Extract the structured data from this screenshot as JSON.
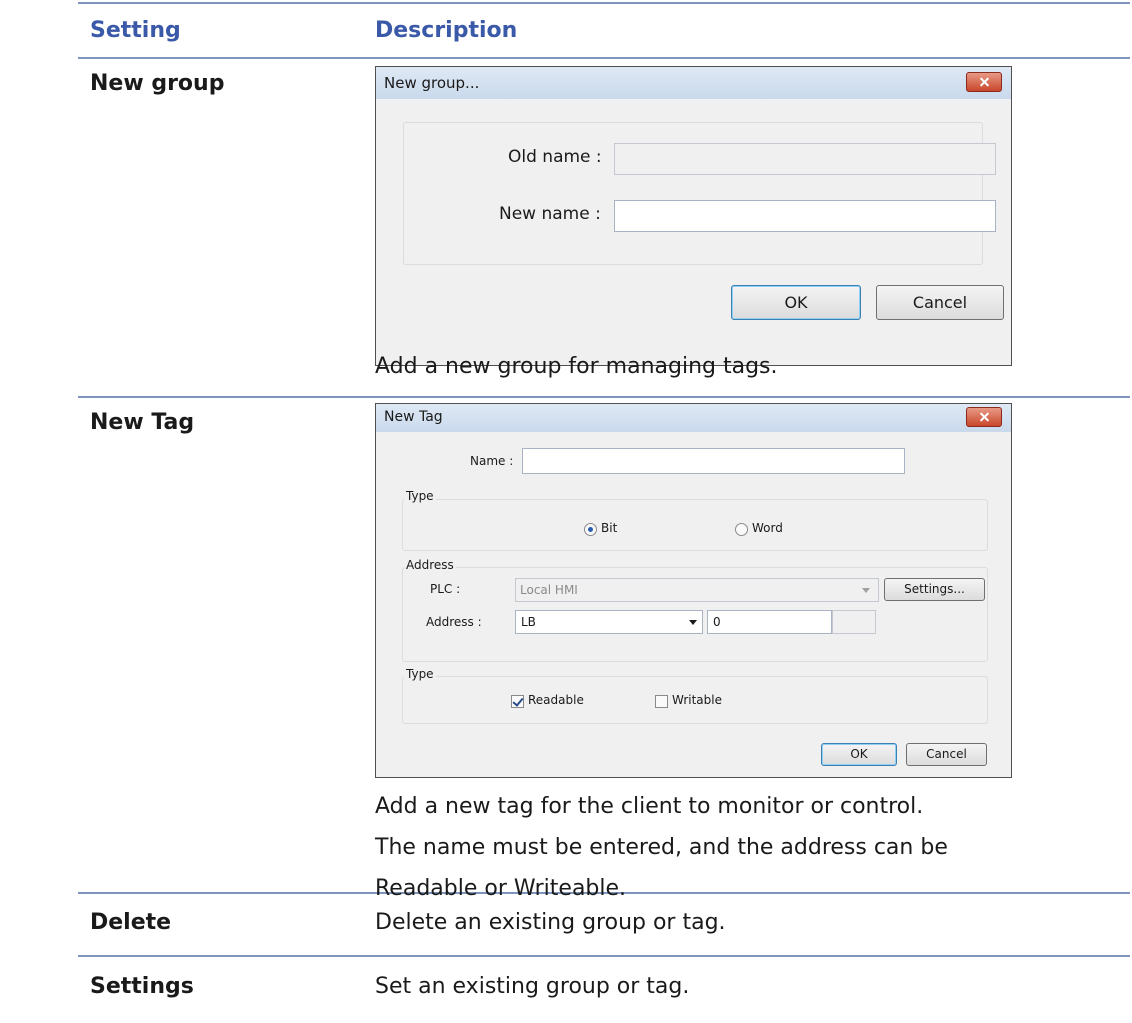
{
  "table": {
    "header": {
      "setting": "Setting",
      "description": "Description"
    },
    "rows": [
      {
        "setting": "New group",
        "description": [
          "Add a new group for managing tags."
        ]
      },
      {
        "setting": "New Tag",
        "description": [
          "Add a new tag for the client to monitor or control.",
          "The name must be entered, and the address can be",
          "Readable or Writeable."
        ]
      },
      {
        "setting": "Delete",
        "description": [
          "Delete an existing group or tag."
        ]
      },
      {
        "setting": "Settings",
        "description": [
          "Set an existing group or tag."
        ]
      }
    ]
  },
  "new_group_dialog": {
    "title": "New group...",
    "old_name_label": "Old name :",
    "old_name_value": "",
    "new_name_label": "New name :",
    "new_name_value": "",
    "ok_label": "OK",
    "cancel_label": "Cancel"
  },
  "new_tag_dialog": {
    "title": "New Tag",
    "name_label": "Name :",
    "name_value": "",
    "type_group_title": "Type",
    "type_options": [
      {
        "label": "Bit",
        "selected": true
      },
      {
        "label": "Word",
        "selected": false
      }
    ],
    "address_group_title": "Address",
    "plc_label": "PLC :",
    "plc_value": "Local HMI",
    "settings_button_label": "Settings...",
    "address_label": "Address :",
    "address_type_value": "LB",
    "address_number_value": "0",
    "access_group_title": "Type",
    "access_options": [
      {
        "label": "Readable",
        "checked": true
      },
      {
        "label": "Writable",
        "checked": false
      }
    ],
    "ok_label": "OK",
    "cancel_label": "Cancel"
  },
  "icons": {
    "close": "close-icon",
    "dropdown": "chevron-down-icon"
  },
  "colors": {
    "header_text": "#3a59a8",
    "rule": "#7f95bd",
    "close_button": "#c9472c"
  }
}
